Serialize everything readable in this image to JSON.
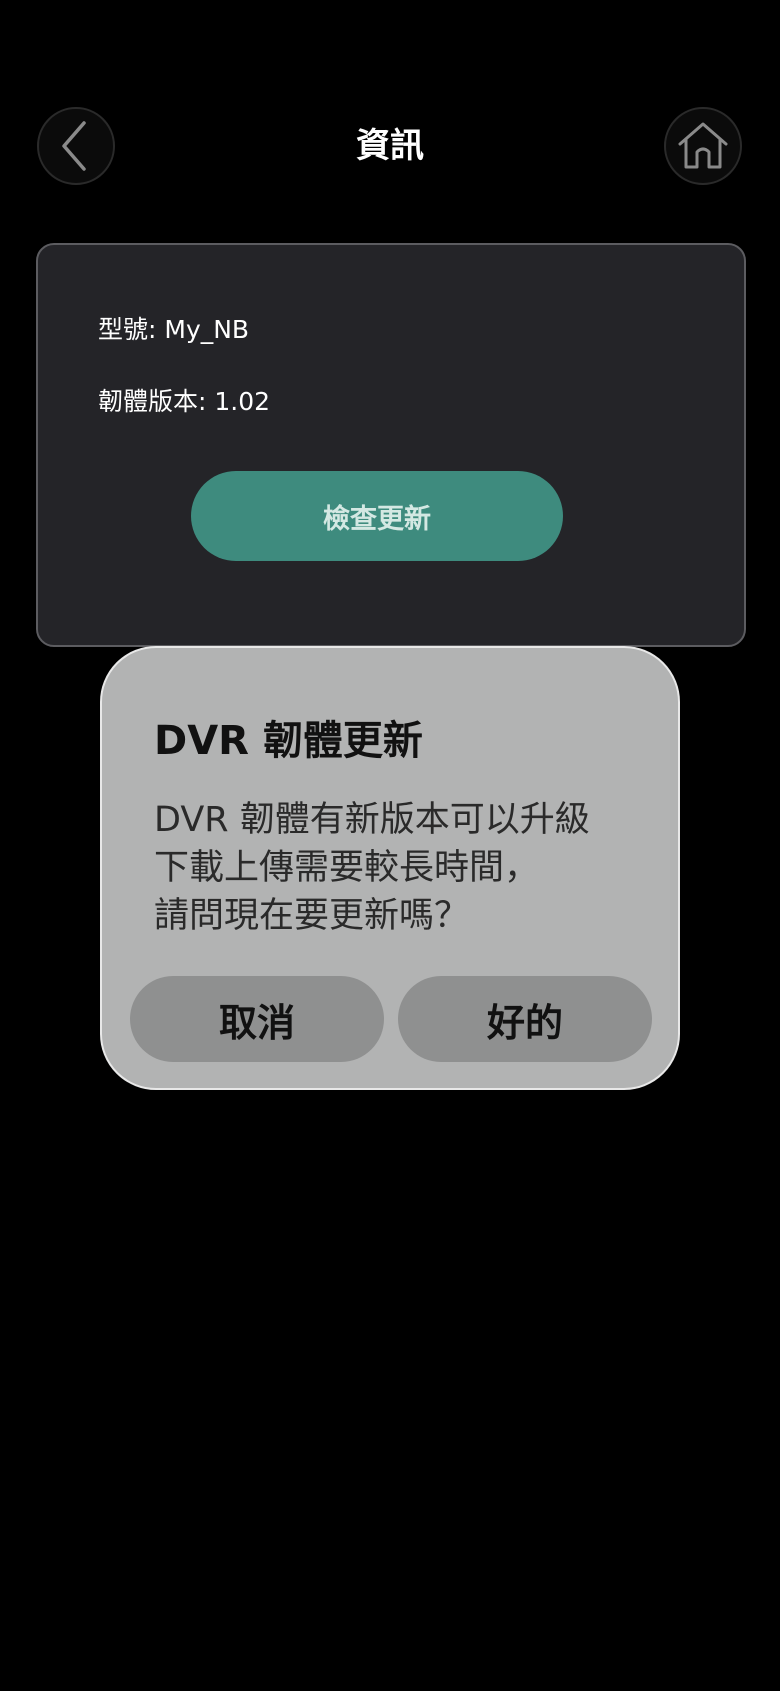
{
  "header": {
    "title": "資訊",
    "back_icon": "chevron-left-icon",
    "home_icon": "home-icon"
  },
  "info": {
    "model_text": "型號: My_NB",
    "firmware_text": "韌體版本: 1.02",
    "check_update_label": "檢查更新"
  },
  "dialog": {
    "title": "DVR 韌體更新",
    "message_lines": [
      "DVR 韌體有新版本可以升級",
      "下載上傳需要較長時間，",
      "請問現在要更新嗎？"
    ],
    "cancel_label": "取消",
    "ok_label": "好的"
  },
  "colors": {
    "background": "#000000",
    "card": "#242428",
    "accent": "#3e8b7e",
    "dialog": "#b2b3b3",
    "dialog_button": "#8f9090"
  }
}
